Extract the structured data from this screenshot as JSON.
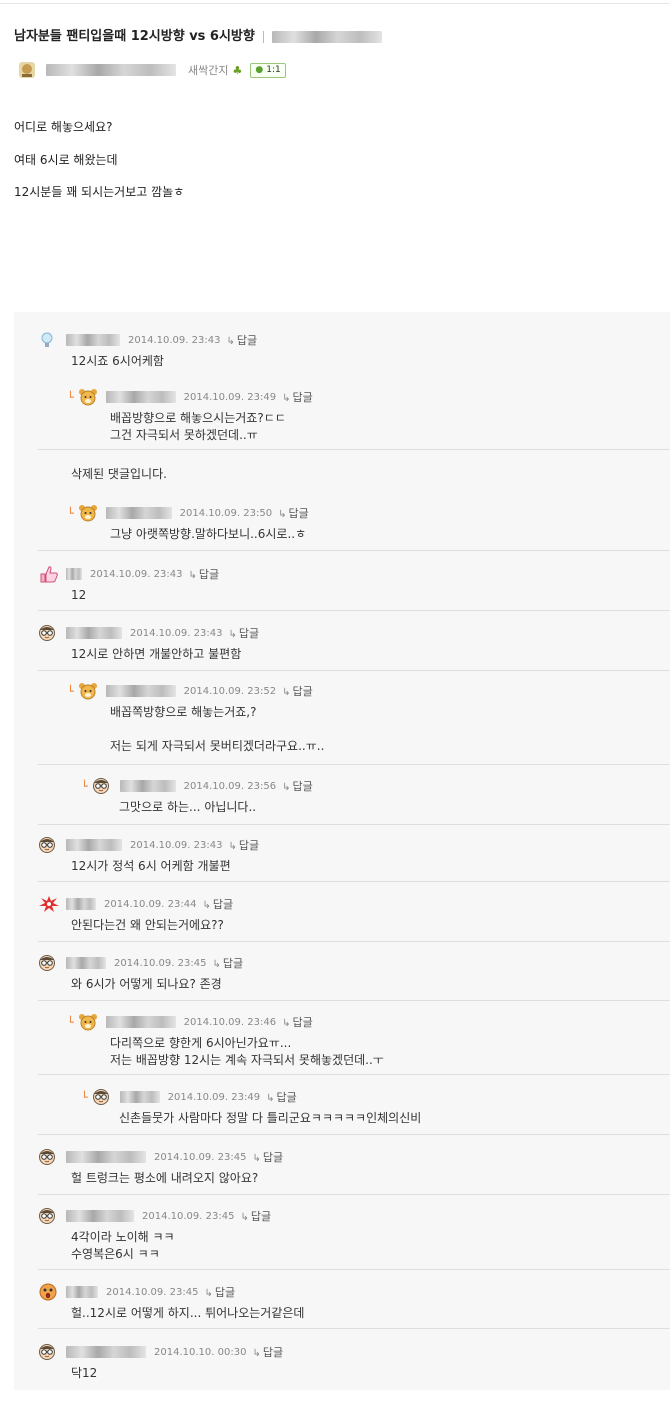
{
  "post": {
    "title": "남자분들 팬티입을때 12시방향 vs 6시방향",
    "author_level": "새싹간지",
    "comment_count": "1:1",
    "body_lines": [
      "어디로 해놓으세요?",
      "여태 6시로 해왔는데",
      "12시분들 꽤 되시는거보고 깜놀ㅎ"
    ]
  },
  "ui": {
    "reply_label": "답글",
    "reply_arrow": "↳"
  },
  "comments": [
    {
      "date": "2014.10.09. 23:43",
      "text": [
        "12시죠 6시어케함"
      ],
      "icon": "bulb-icon"
    },
    {
      "date": "2014.10.09. 23:49",
      "text": [
        "배꼽방향으로 해놓으시는거죠?ㄷㄷ",
        "그건 자극되서 못하겠던데..ㅠ"
      ],
      "icon": "bear-icon"
    },
    {
      "deleted": "삭제된 댓글입니다."
    },
    {
      "date": "2014.10.09. 23:50",
      "text": [
        "그냥 아랫쪽방향.말하다보니..6시로..ㅎ"
      ],
      "icon": "bear-icon"
    },
    {
      "date": "2014.10.09. 23:43",
      "text": [
        "12"
      ],
      "icon": "thumb-icon"
    },
    {
      "date": "2014.10.09. 23:43",
      "text": [
        "12시로 안하면 개불안하고 불편함"
      ],
      "icon": "glasses-face-icon"
    },
    {
      "date": "2014.10.09. 23:52",
      "text": [
        "배꼽쪽방향으로 해놓는거죠,?",
        "",
        "저는 되게 자극되서 못버티겠더라구요..ㅠ.."
      ],
      "icon": "bear-icon"
    },
    {
      "date": "2014.10.09. 23:56",
      "text": [
        "그맛으로 하는... 아닙니다.."
      ],
      "icon": "glasses-face-icon"
    },
    {
      "date": "2014.10.09. 23:43",
      "text": [
        "12시가 정석 6시 어케함 개불편"
      ],
      "icon": "glasses-face-icon"
    },
    {
      "date": "2014.10.09. 23:44",
      "text": [
        "안된다는건 왜 안되는거에요??"
      ],
      "icon": "splash-icon"
    },
    {
      "date": "2014.10.09. 23:45",
      "text": [
        "와 6시가 어떻게 되나요? 존경"
      ],
      "icon": "glasses-face-icon"
    },
    {
      "date": "2014.10.09. 23:46",
      "text": [
        "다리쪽으로 향한게 6시아닌가요ㅠ...",
        "저는 배꼽방향 12시는 계속 자극되서 못해놓겠던데..ㅜ"
      ],
      "icon": "bear-icon"
    },
    {
      "date": "2014.10.09. 23:49",
      "text": [
        "신촌들뭇가 사람마다 정말 다 틀리군요ㅋㅋㅋㅋㅋ인체의신비"
      ],
      "icon": "glasses-face-icon"
    },
    {
      "date": "2014.10.09. 23:45",
      "text": [
        "헐 트렁크는 평소에 내려오지 않아요?"
      ],
      "icon": "glasses-face-icon"
    },
    {
      "date": "2014.10.09. 23:45",
      "text": [
        "4각이라 노이해 ㅋㅋ",
        "수영복은6시 ㅋㅋ"
      ],
      "icon": "glasses-face-icon"
    },
    {
      "date": "2014.10.09. 23:45",
      "text": [
        "헐..12시로 어떻게 하지... 튀어나오는거같은데"
      ],
      "icon": "surprised-face-icon"
    },
    {
      "date": "2014.10.10. 00:30",
      "text": [
        "닥12"
      ],
      "icon": "glasses-face-icon"
    }
  ]
}
